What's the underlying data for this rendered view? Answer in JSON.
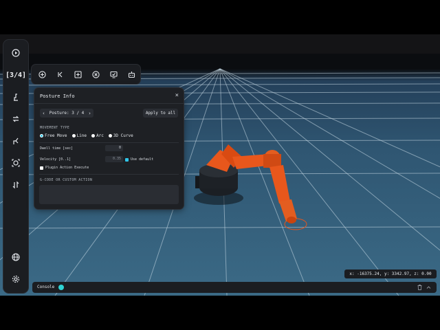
{
  "rail": {
    "play_icon": "play-icon",
    "counter": "[3/4]",
    "items": [
      "robot-arm-icon",
      "transform-icon",
      "gripper-icon",
      "target-icon",
      "swap-icon"
    ],
    "globe_icon": "globe-icon",
    "settings_icon": "gear-icon"
  },
  "toolbar": {
    "buttons": [
      "add-circle-icon",
      "skip-back-icon",
      "add-square-icon",
      "cancel-circle-icon",
      "monitor-check-icon",
      "robot-icon"
    ]
  },
  "posture_panel": {
    "title": "Posture Info",
    "close": "×",
    "posture_label": "Posture: 3 / 4",
    "prev": "‹",
    "next": "›",
    "apply_all": "Apply to all",
    "movement_type_heading": "MOVEMENT TYPE",
    "movement_options": [
      "Free Move",
      "Line",
      "Arc",
      "3D Curve"
    ],
    "movement_selected": "Free Move",
    "dwell_label": "Dwell time [sec]",
    "dwell_value": "0",
    "velocity_label": "Velocity [0..1]",
    "velocity_value": "0.35",
    "use_default_label": "Use default",
    "use_default_checked": true,
    "plugin_label": "Plugin Action Execute",
    "plugin_checked": false,
    "gcode_heading": "G-CODE OR CUSTOM ACTION",
    "gcode_value": ""
  },
  "coords": "x: -16375.24, y: 3342.97, z: 0.00",
  "console": {
    "label": "Console",
    "trash_icon": "trash-icon",
    "collapse_icon": "chevron-up-icon"
  },
  "colors": {
    "accent": "#2fc5e8",
    "robot": "#e8571c",
    "floor": "#35627e"
  }
}
